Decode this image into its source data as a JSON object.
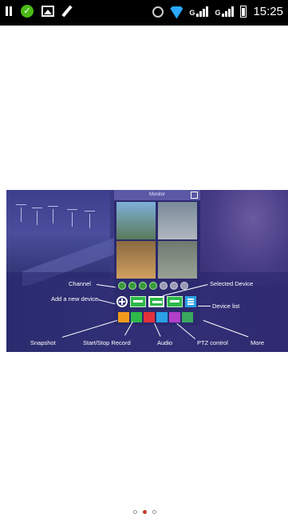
{
  "status_bar": {
    "time": "15:25",
    "network_left": "G",
    "network_right": "G"
  },
  "banner": {
    "phone_title": "Monitor",
    "labels": {
      "channel": "Channel",
      "add_device": "Add a new device",
      "selected_device": "Selected Device",
      "device_list": "Device list",
      "snapshot": "Snapshot",
      "record": "Start/Stop Record",
      "audio": "Audio",
      "ptz": "PTZ control",
      "more": "More"
    },
    "channels": 7,
    "selected_channels": 4
  },
  "pager": {
    "pages": 3,
    "active_page": 2
  }
}
